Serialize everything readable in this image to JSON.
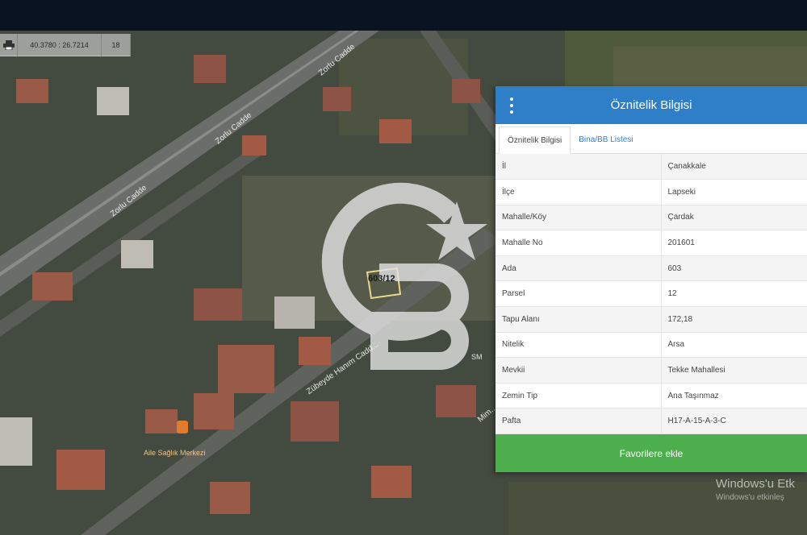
{
  "map": {
    "toolbar": {
      "printer_icon": "printer-icon",
      "coordinates": "40.3780 : 26.7214",
      "zoom_level": "18"
    },
    "street_labels": [
      "Zorlu Cadde",
      "Zorlu Cadde",
      "Zorlu Cadde",
      "Zübeyde Hanım Cadd...",
      "Mim..."
    ],
    "parcel_label": "603/12",
    "poi_label": "Aile Sağlık Merkezi",
    "watermark_label": "SM"
  },
  "panel": {
    "title": "Öznitelik Bilgisi",
    "tabs": [
      "Öznitelik Bilgisi",
      "Bina/BB Listesi"
    ],
    "rows": [
      {
        "key": "İl",
        "value": "Çanakkale"
      },
      {
        "key": "İlçe",
        "value": "Lapseki"
      },
      {
        "key": "Mahalle/Köy",
        "value": "Çardak"
      },
      {
        "key": "Mahalle No",
        "value": "201601"
      },
      {
        "key": "Ada",
        "value": "603"
      },
      {
        "key": "Parsel",
        "value": "12"
      },
      {
        "key": "Tapu Alanı",
        "value": "172,18"
      },
      {
        "key": "Nitelik",
        "value": "Arsa"
      },
      {
        "key": "Mevkii",
        "value": "Tekke Mahallesi"
      },
      {
        "key": "Zemin Tip",
        "value": "Ana Taşınmaz"
      },
      {
        "key": "Pafta",
        "value": "H17-A-15-A-3-C"
      }
    ],
    "favorite_button": "Favorilere ekle"
  },
  "windows_watermark": {
    "title": "Windows'u Etk",
    "subtitle": "Windows'u etkinleş"
  }
}
